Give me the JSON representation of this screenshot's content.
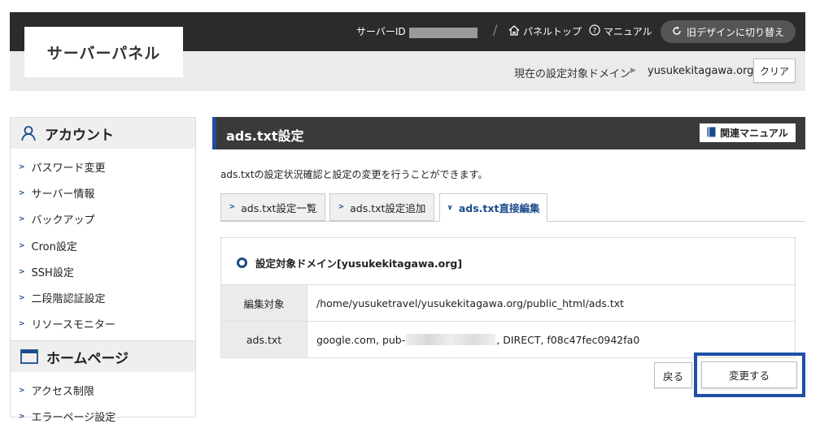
{
  "header": {
    "logo": "サーバーパネル",
    "server_id_label": "サーバーID",
    "panel_top": "パネルトップ",
    "manual": "マニュアル",
    "old_design": "旧デザインに切り替え",
    "slash": "/"
  },
  "domain_bar": {
    "label": "現在の設定対象ドメイン",
    "value": "yusukekitagawa.org",
    "clear": "クリア"
  },
  "sidebar": {
    "account_title": "アカウント",
    "account_items": [
      {
        "label": "パスワード変更"
      },
      {
        "label": "サーバー情報"
      },
      {
        "label": "バックアップ"
      },
      {
        "label": "Cron設定"
      },
      {
        "label": "SSH設定"
      },
      {
        "label": "二段階認証設定"
      },
      {
        "label": "リソースモニター"
      }
    ],
    "homepage_title": "ホームページ",
    "homepage_items": [
      {
        "label": "アクセス制限"
      },
      {
        "label": "エラーページ設定"
      }
    ]
  },
  "main": {
    "title": "ads.txt設定",
    "manual_link": "関連マニュアル",
    "description": "ads.txtの設定状況確認と設定の変更を行うことができます。",
    "tabs": [
      {
        "label": "ads.txt設定一覧"
      },
      {
        "label": "ads.txt設定追加"
      },
      {
        "label": "ads.txt直接編集"
      }
    ],
    "panel_heading": "設定対象ドメイン[yusukekitagawa.org]",
    "rows": [
      {
        "key": "編集対象",
        "value": "/home/yusuketravel/yusukekitagawa.org/public_html/ads.txt"
      },
      {
        "key": "ads.txt",
        "value_prefix": "google.com, pub-",
        "value_suffix": ", DIRECT, f08c47fec0942fa0"
      }
    ],
    "back_button": "戻る",
    "change_button": "変更する"
  },
  "colors": {
    "accent": "#1a4b8c",
    "header_bg": "#2b2b2b",
    "highlight": "#1f4fa8"
  }
}
